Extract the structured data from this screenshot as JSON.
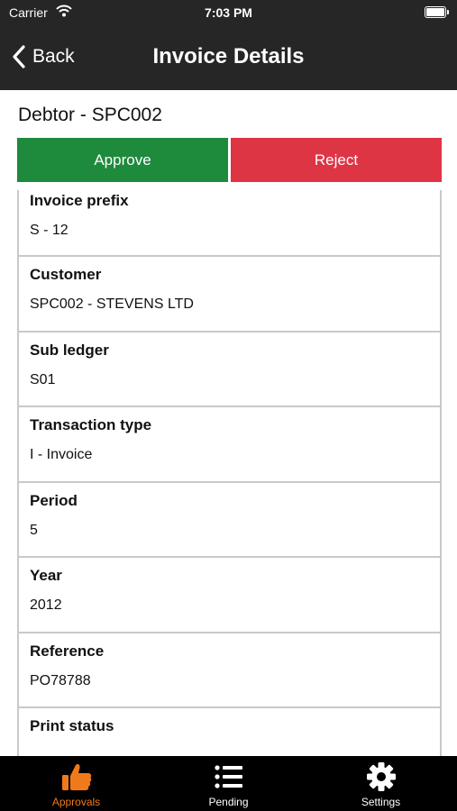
{
  "status_bar": {
    "carrier": "Carrier",
    "time": "7:03 PM"
  },
  "nav": {
    "back_label": "Back",
    "title": "Invoice Details"
  },
  "header": {
    "debtor": "Debtor - SPC002"
  },
  "actions": {
    "approve_label": "Approve",
    "reject_label": "Reject",
    "approve_color": "#1e8a3c",
    "reject_color": "#de3545"
  },
  "fields": [
    {
      "label": "Invoice prefix",
      "value": "S - 12"
    },
    {
      "label": "Customer",
      "value": "SPC002 - STEVENS LTD"
    },
    {
      "label": "Sub ledger",
      "value": "S01"
    },
    {
      "label": "Transaction type",
      "value": "I - Invoice"
    },
    {
      "label": "Period",
      "value": "5"
    },
    {
      "label": "Year",
      "value": "2012"
    },
    {
      "label": "Reference",
      "value": "PO78788"
    },
    {
      "label": "Print status",
      "value": ""
    }
  ],
  "tabbar": {
    "active_color": "#f07a1a",
    "tabs": [
      {
        "label": "Approvals",
        "icon": "thumbs-up-icon",
        "active": true
      },
      {
        "label": "Pending",
        "icon": "list-icon",
        "active": false
      },
      {
        "label": "Settings",
        "icon": "gear-icon",
        "active": false
      }
    ]
  }
}
